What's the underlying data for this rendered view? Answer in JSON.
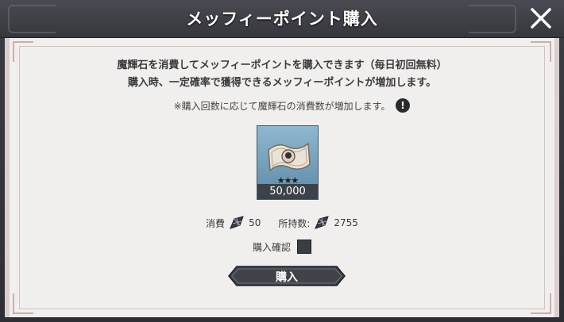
{
  "header": {
    "title": "メッフィーポイント購入",
    "close_icon": "close-icon"
  },
  "description": {
    "line1": "魔輝石を消費してメッフィーポイントを購入できます（毎日初回無料）",
    "line2": "購入時、一定確率で獲得できるメッフィーポイントが増加します。",
    "note": "※購入回数に応じて魔輝石の消費数が増加します。"
  },
  "item": {
    "icon": "banknote-icon",
    "stars": "★★★",
    "count": "50,000"
  },
  "cost": {
    "consume_label": "消費",
    "consume_value": "50",
    "owned_label": "所持数:",
    "owned_value": "2755",
    "currency_icon": "magic-stone-icon"
  },
  "confirm": {
    "label": "購入確認",
    "checked": false
  },
  "buy_button": {
    "label": "購入"
  },
  "colors": {
    "header_bg": "#3d3d44",
    "panel_bg": "#f1efee",
    "accent_border": "#c9aeac",
    "card_bg": "#7aa3be"
  }
}
